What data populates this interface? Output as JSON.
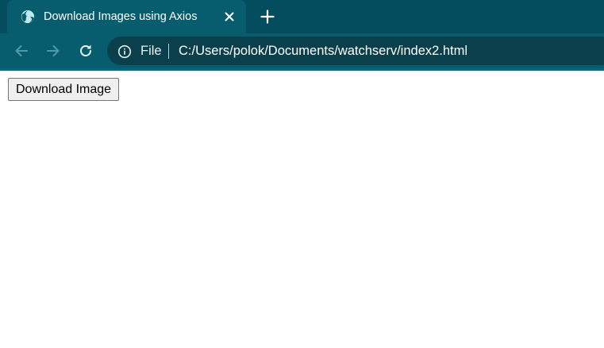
{
  "window": {
    "tab": {
      "title": "Download Images using Axios",
      "favicon": "globe-icon",
      "close_icon": "close-icon"
    },
    "new_tab_icon": "plus-icon"
  },
  "toolbar": {
    "back_icon": "arrow-left-icon",
    "forward_icon": "arrow-right-icon",
    "reload_icon": "reload-icon",
    "omnibox": {
      "info_icon": "info-icon",
      "scheme_label": "File",
      "url": "C:/Users/polok/Documents/watchserv/index2.html"
    }
  },
  "page": {
    "download_button_label": "Download Image"
  },
  "colors": {
    "tabstrip": "#034d5e",
    "active_tab": "#075c6d",
    "omnibox": "#0a3f4c",
    "page_background": "#ffffff"
  }
}
